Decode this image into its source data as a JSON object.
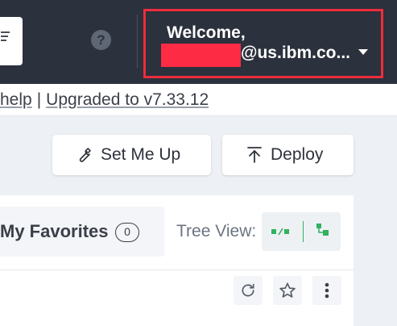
{
  "header": {
    "welcome_label": "Welcome,",
    "email_visible": "@us.ibm.co...",
    "help_glyph": "?",
    "icons": [
      "menu-icon",
      "help-icon",
      "dropdown-caret-icon"
    ],
    "highlight_color": "#ee2c3c",
    "redaction_color": "#fe2b44"
  },
  "linkbar": {
    "help_link": "help",
    "separator": "|",
    "version_link": "Upgraded to v7.33.12"
  },
  "actions": {
    "setup_label": "Set Me Up",
    "deploy_label": "Deploy",
    "icons": [
      "wrench-icon",
      "upload-arrow-icon"
    ]
  },
  "panel": {
    "favorites_label": "My Favorites",
    "favorites_count": "0",
    "tree_view_label": "Tree View:",
    "tree_icons": [
      "flat-tree-icon",
      "nested-tree-icon"
    ],
    "row_icons": [
      "refresh-icon",
      "star-icon",
      "more-vertical-icon"
    ],
    "tree_icon_color": "#2fb35f"
  }
}
